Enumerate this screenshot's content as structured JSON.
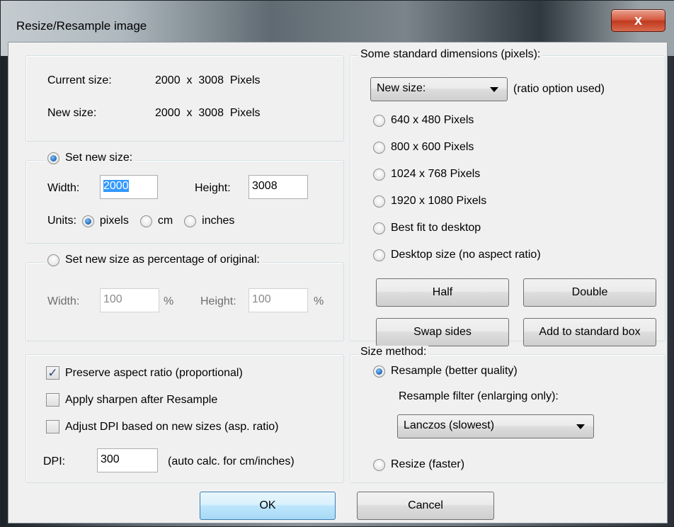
{
  "window": {
    "title": "Resize/Resample image",
    "close_label": "x"
  },
  "current": {
    "current_label": "Current size:",
    "current_value": "2000  x  3008  Pixels",
    "new_label": "New size:",
    "new_value": "2000  x  3008  Pixels"
  },
  "set_size": {
    "radio_label": "Set new size:",
    "width_label": "Width:",
    "width_value": "2000",
    "height_label": "Height:",
    "height_value": "3008",
    "units_label": "Units:",
    "unit_pixels": "pixels",
    "unit_cm": "cm",
    "unit_inches": "inches"
  },
  "percentage": {
    "radio_label": "Set new size as percentage of original:",
    "width_label": "Width:",
    "width_value": "100",
    "width_unit": "%",
    "height_label": "Height:",
    "height_value": "100",
    "height_unit": "%"
  },
  "options": {
    "preserve_label": "Preserve aspect ratio (proportional)",
    "sharpen_label": "Apply sharpen after Resample",
    "dpi_adjust_label": "Adjust DPI based on new sizes (asp. ratio)",
    "dpi_label": "DPI:",
    "dpi_value": "300",
    "dpi_note": "(auto calc. for cm/inches)",
    "check_mark": "✓"
  },
  "standard": {
    "legend": "Some standard dimensions (pixels):",
    "dropdown_value": "New size:",
    "dropdown_note": "(ratio option used)",
    "options": [
      "640 x 480 Pixels",
      "800 x 600 Pixels",
      "1024 x 768 Pixels",
      "1920 x 1080 Pixels",
      "Best fit to desktop",
      "Desktop size (no aspect ratio)"
    ],
    "half_label": "Half",
    "double_label": "Double",
    "swap_label": "Swap sides",
    "add_label": "Add to standard box"
  },
  "method": {
    "legend": "Size method:",
    "resample_label": "Resample (better quality)",
    "filter_label": "Resample filter (enlarging only):",
    "filter_value": "Lanczos (slowest)",
    "resize_label": "Resize (faster)"
  },
  "footer": {
    "ok_label": "OK",
    "cancel_label": "Cancel"
  }
}
